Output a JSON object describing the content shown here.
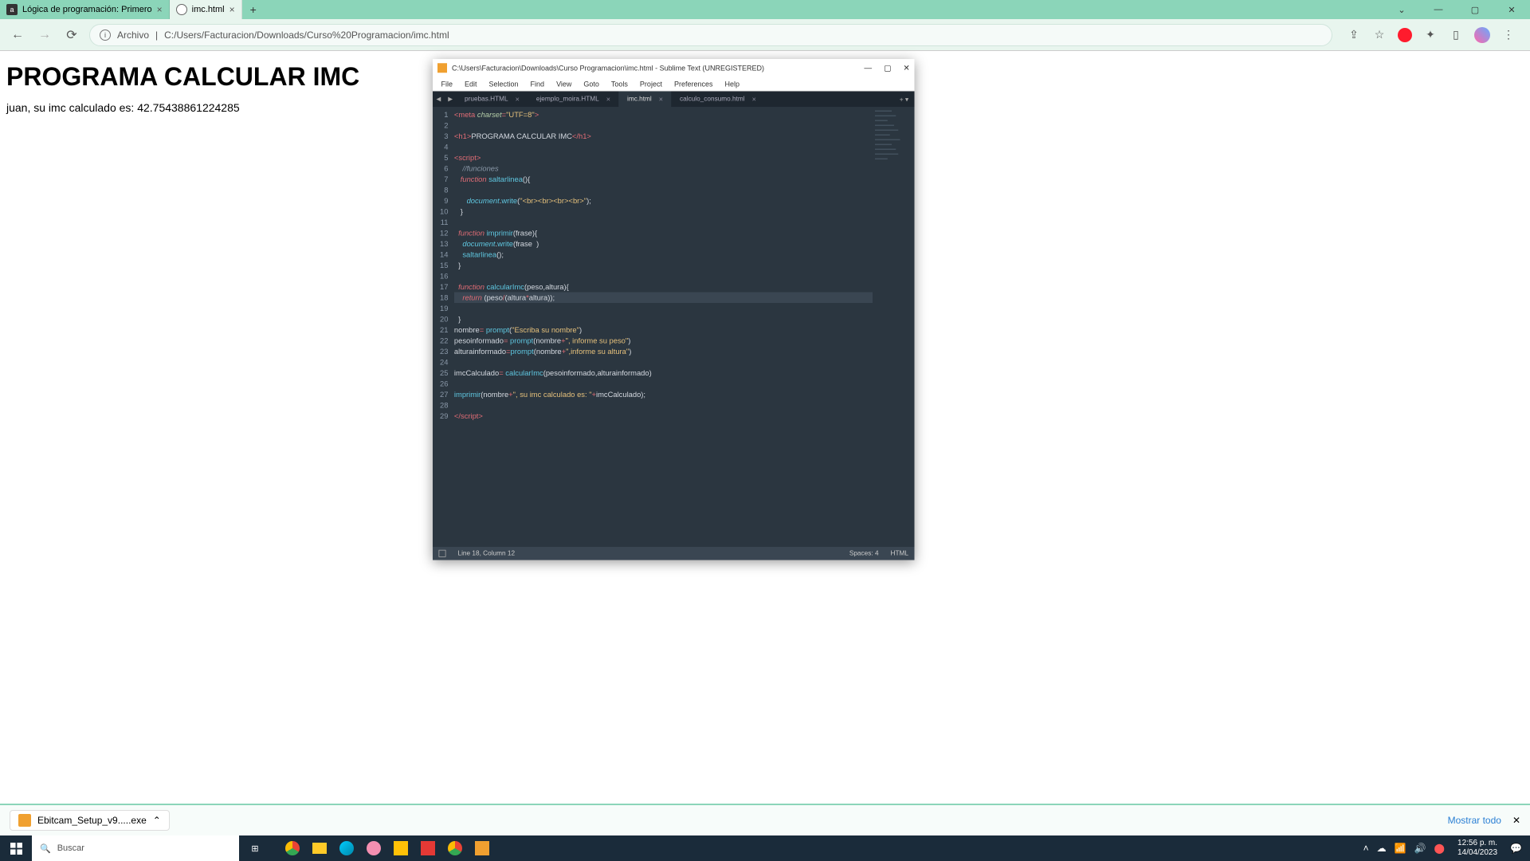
{
  "browser": {
    "tabs": [
      {
        "title": "Lógica de programación: Primero",
        "active": false
      },
      {
        "title": "imc.html",
        "active": true
      }
    ],
    "win": {
      "min": "—",
      "max": "▢",
      "close": "✕"
    },
    "addr": {
      "scheme_label": "Archivo",
      "url": "C:/Users/Facturacion/Downloads/Curso%20Programacion/imc.html"
    }
  },
  "page": {
    "h1": "PROGRAMA CALCULAR IMC",
    "line": "juan, su imc calculado es: 42.75438861224285"
  },
  "sublime": {
    "title": "C:\\Users\\Facturacion\\Downloads\\Curso Programacion\\imc.html - Sublime Text (UNREGISTERED)",
    "menu": [
      "File",
      "Edit",
      "Selection",
      "Find",
      "View",
      "Goto",
      "Tools",
      "Project",
      "Preferences",
      "Help"
    ],
    "tabs": [
      {
        "name": "pruebas.HTML",
        "active": false
      },
      {
        "name": "ejemplo_moira.HTML",
        "active": false
      },
      {
        "name": "imc.html",
        "active": true
      },
      {
        "name": "calculo_consumo.html",
        "active": false
      }
    ],
    "status": {
      "pos": "Line 18, Column 12",
      "spaces": "Spaces: 4",
      "lang": "HTML"
    },
    "win": {
      "min": "—",
      "max": "▢",
      "close": "✕"
    }
  },
  "download": {
    "file": "Ebitcam_Setup_v9.....exe",
    "showall": "Mostrar todo"
  },
  "taskbar": {
    "search": "Buscar",
    "time": "12:56 p. m.",
    "date": "14/04/2023"
  }
}
